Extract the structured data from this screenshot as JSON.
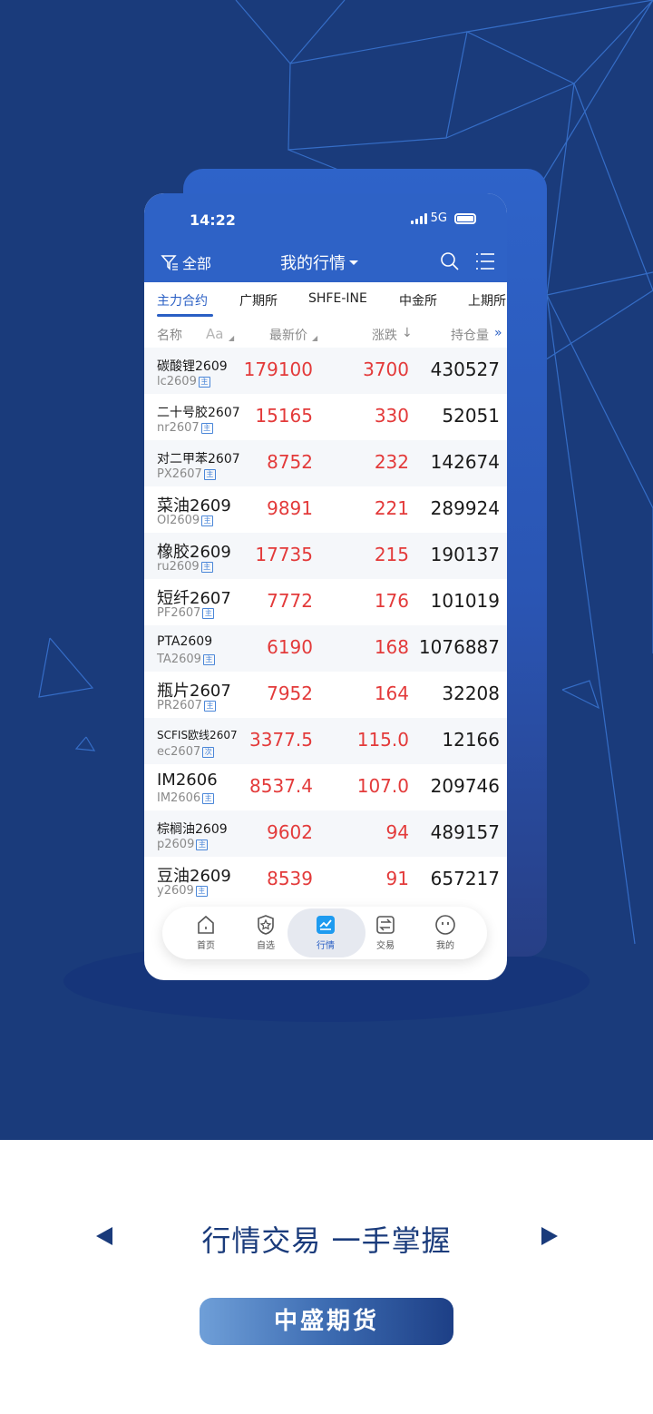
{
  "status": {
    "time": "14:22",
    "network": "5G"
  },
  "nav": {
    "filter_label": "全部",
    "title": "我的行情"
  },
  "tabs": [
    "主力合约",
    "广期所",
    "SHFE-INE",
    "中金所",
    "上期所"
  ],
  "columns": {
    "name": "名称",
    "font_toggle": "Aa",
    "price": "最新价",
    "change": "涨跌",
    "change_arrow": "↓",
    "open_interest": "持仓量",
    "more": "»"
  },
  "rows": [
    {
      "name": "碳酸锂2609",
      "code": "lc2609",
      "badge": "主",
      "price": "179100",
      "change": "3700",
      "oi": "430527"
    },
    {
      "name": "二十号胶2607",
      "code": "nr2607",
      "badge": "主",
      "price": "15165",
      "change": "330",
      "oi": "52051"
    },
    {
      "name": "对二甲苯2607",
      "code": "PX2607",
      "badge": "主",
      "price": "8752",
      "change": "232",
      "oi": "142674"
    },
    {
      "name": "菜油2609",
      "code": "OI2609",
      "badge": "主",
      "price": "9891",
      "change": "221",
      "oi": "289924"
    },
    {
      "name": "橡胶2609",
      "code": "ru2609",
      "badge": "主",
      "price": "17735",
      "change": "215",
      "oi": "190137"
    },
    {
      "name": "短纤2607",
      "code": "PF2607",
      "badge": "主",
      "price": "7772",
      "change": "176",
      "oi": "101019"
    },
    {
      "name": "PTA2609",
      "code": "TA2609",
      "badge": "主",
      "price": "6190",
      "change": "168",
      "oi": "1076887"
    },
    {
      "name": "瓶片2607",
      "code": "PR2607",
      "badge": "主",
      "price": "7952",
      "change": "164",
      "oi": "32208"
    },
    {
      "name": "SCFIS欧线2607",
      "code": "ec2607",
      "badge": "次",
      "price": "3377.5",
      "change": "115.0",
      "oi": "12166"
    },
    {
      "name": "IM2606",
      "code": "IM2606",
      "badge": "主",
      "price": "8537.4",
      "change": "107.0",
      "oi": "209746"
    },
    {
      "name": "棕榈油2609",
      "code": "p2609",
      "badge": "主",
      "price": "9602",
      "change": "94",
      "oi": "489157"
    },
    {
      "name": "豆油2609",
      "code": "y2609",
      "badge": "主",
      "price": "8539",
      "change": "91",
      "oi": "657217"
    }
  ],
  "tabbar": [
    {
      "label": "首页",
      "icon": "home-icon"
    },
    {
      "label": "自选",
      "icon": "star-shield-icon"
    },
    {
      "label": "行情",
      "icon": "chart-icon"
    },
    {
      "label": "交易",
      "icon": "swap-icon"
    },
    {
      "label": "我的",
      "icon": "face-icon"
    }
  ],
  "slogan": "行情交易 一手掌握",
  "brand_button": "中盛期货",
  "colors": {
    "hero_bg": "#1a3b7b",
    "accent_blue": "#2e62c6",
    "rise_red": "#e33a3a"
  }
}
